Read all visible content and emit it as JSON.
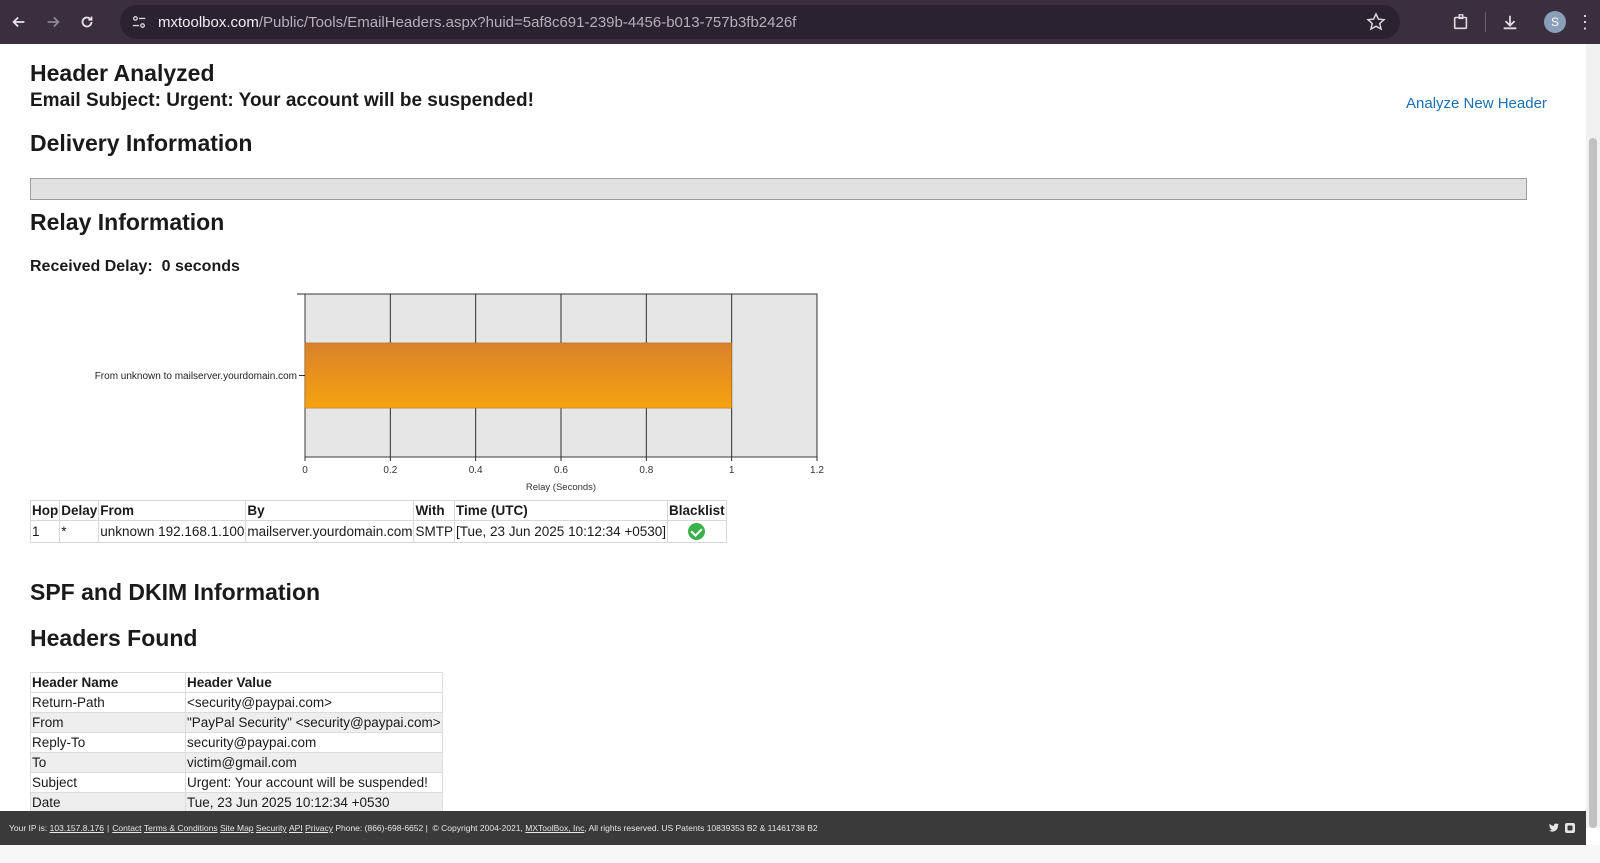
{
  "browser": {
    "url_host": "mxtoolbox.com",
    "url_path": "/Public/Tools/EmailHeaders.aspx?huid=5af8c691-239b-4456-b013-757b3fb2426f",
    "avatar_letter": "S"
  },
  "page": {
    "title": "Header Analyzed",
    "subject": "Email Subject: Urgent: Your account will be suspended!",
    "analyze_link": "Analyze New Header",
    "delivery_heading": "Delivery Information",
    "relay_heading": "Relay Information",
    "received_delay_label": "Received Delay:",
    "received_delay_value": "0 seconds",
    "spf_heading": "SPF and DKIM Information",
    "headers_heading": "Headers Found"
  },
  "chart_data": {
    "type": "bar",
    "orientation": "horizontal",
    "categories": [
      "From unknown to mailserver.yourdomain.com"
    ],
    "values": [
      1
    ],
    "xlabel": "Relay (Seconds)",
    "ylabel": "",
    "xlim": [
      0,
      1.2
    ],
    "xticks": [
      "0",
      "0.2",
      "0.4",
      "0.6",
      "0.8",
      "1",
      "1.2"
    ],
    "grid": true,
    "bar_color": "#f5a310"
  },
  "relay_table": {
    "headers": [
      "Hop",
      "Delay",
      "From",
      "By",
      "With",
      "Time (UTC)",
      "Blacklist"
    ],
    "rows": [
      {
        "hop": "1",
        "delay": "*",
        "from": "unknown 192.168.1.100",
        "by": "mailserver.yourdomain.com",
        "with": "SMTP",
        "time": "[Tue, 23 Jun 2025 10:12:34 +0530]",
        "blacklist": "check-icon"
      }
    ]
  },
  "headers_table": {
    "headers": [
      "Header Name",
      "Header Value"
    ],
    "rows": [
      {
        "name": "Return-Path",
        "value": "<security@paypai.com>"
      },
      {
        "name": "From",
        "value": "\"PayPal Security\" <security@paypai.com>"
      },
      {
        "name": "Reply-To",
        "value": "security@paypai.com"
      },
      {
        "name": "To",
        "value": "victim@gmail.com"
      },
      {
        "name": "Subject",
        "value": "Urgent: Your account will be suspended!"
      },
      {
        "name": "Date",
        "value": "Tue, 23 Jun 2025 10:12:34 +0530"
      }
    ]
  },
  "footer": {
    "ip_label": "Your IP is:",
    "ip": "103.157.8.176",
    "links": [
      "Contact",
      "Terms & Conditions",
      "Site Map",
      "Security",
      "API",
      "Privacy"
    ],
    "phone": "Phone: (866)-698-6652 |",
    "copyright_pre": "© Copyright 2004-2021,",
    "company": "MXToolBox, Inc",
    "copyright_post": ", All rights reserved. US Patents 10839353 B2 & 11461738 B2"
  }
}
